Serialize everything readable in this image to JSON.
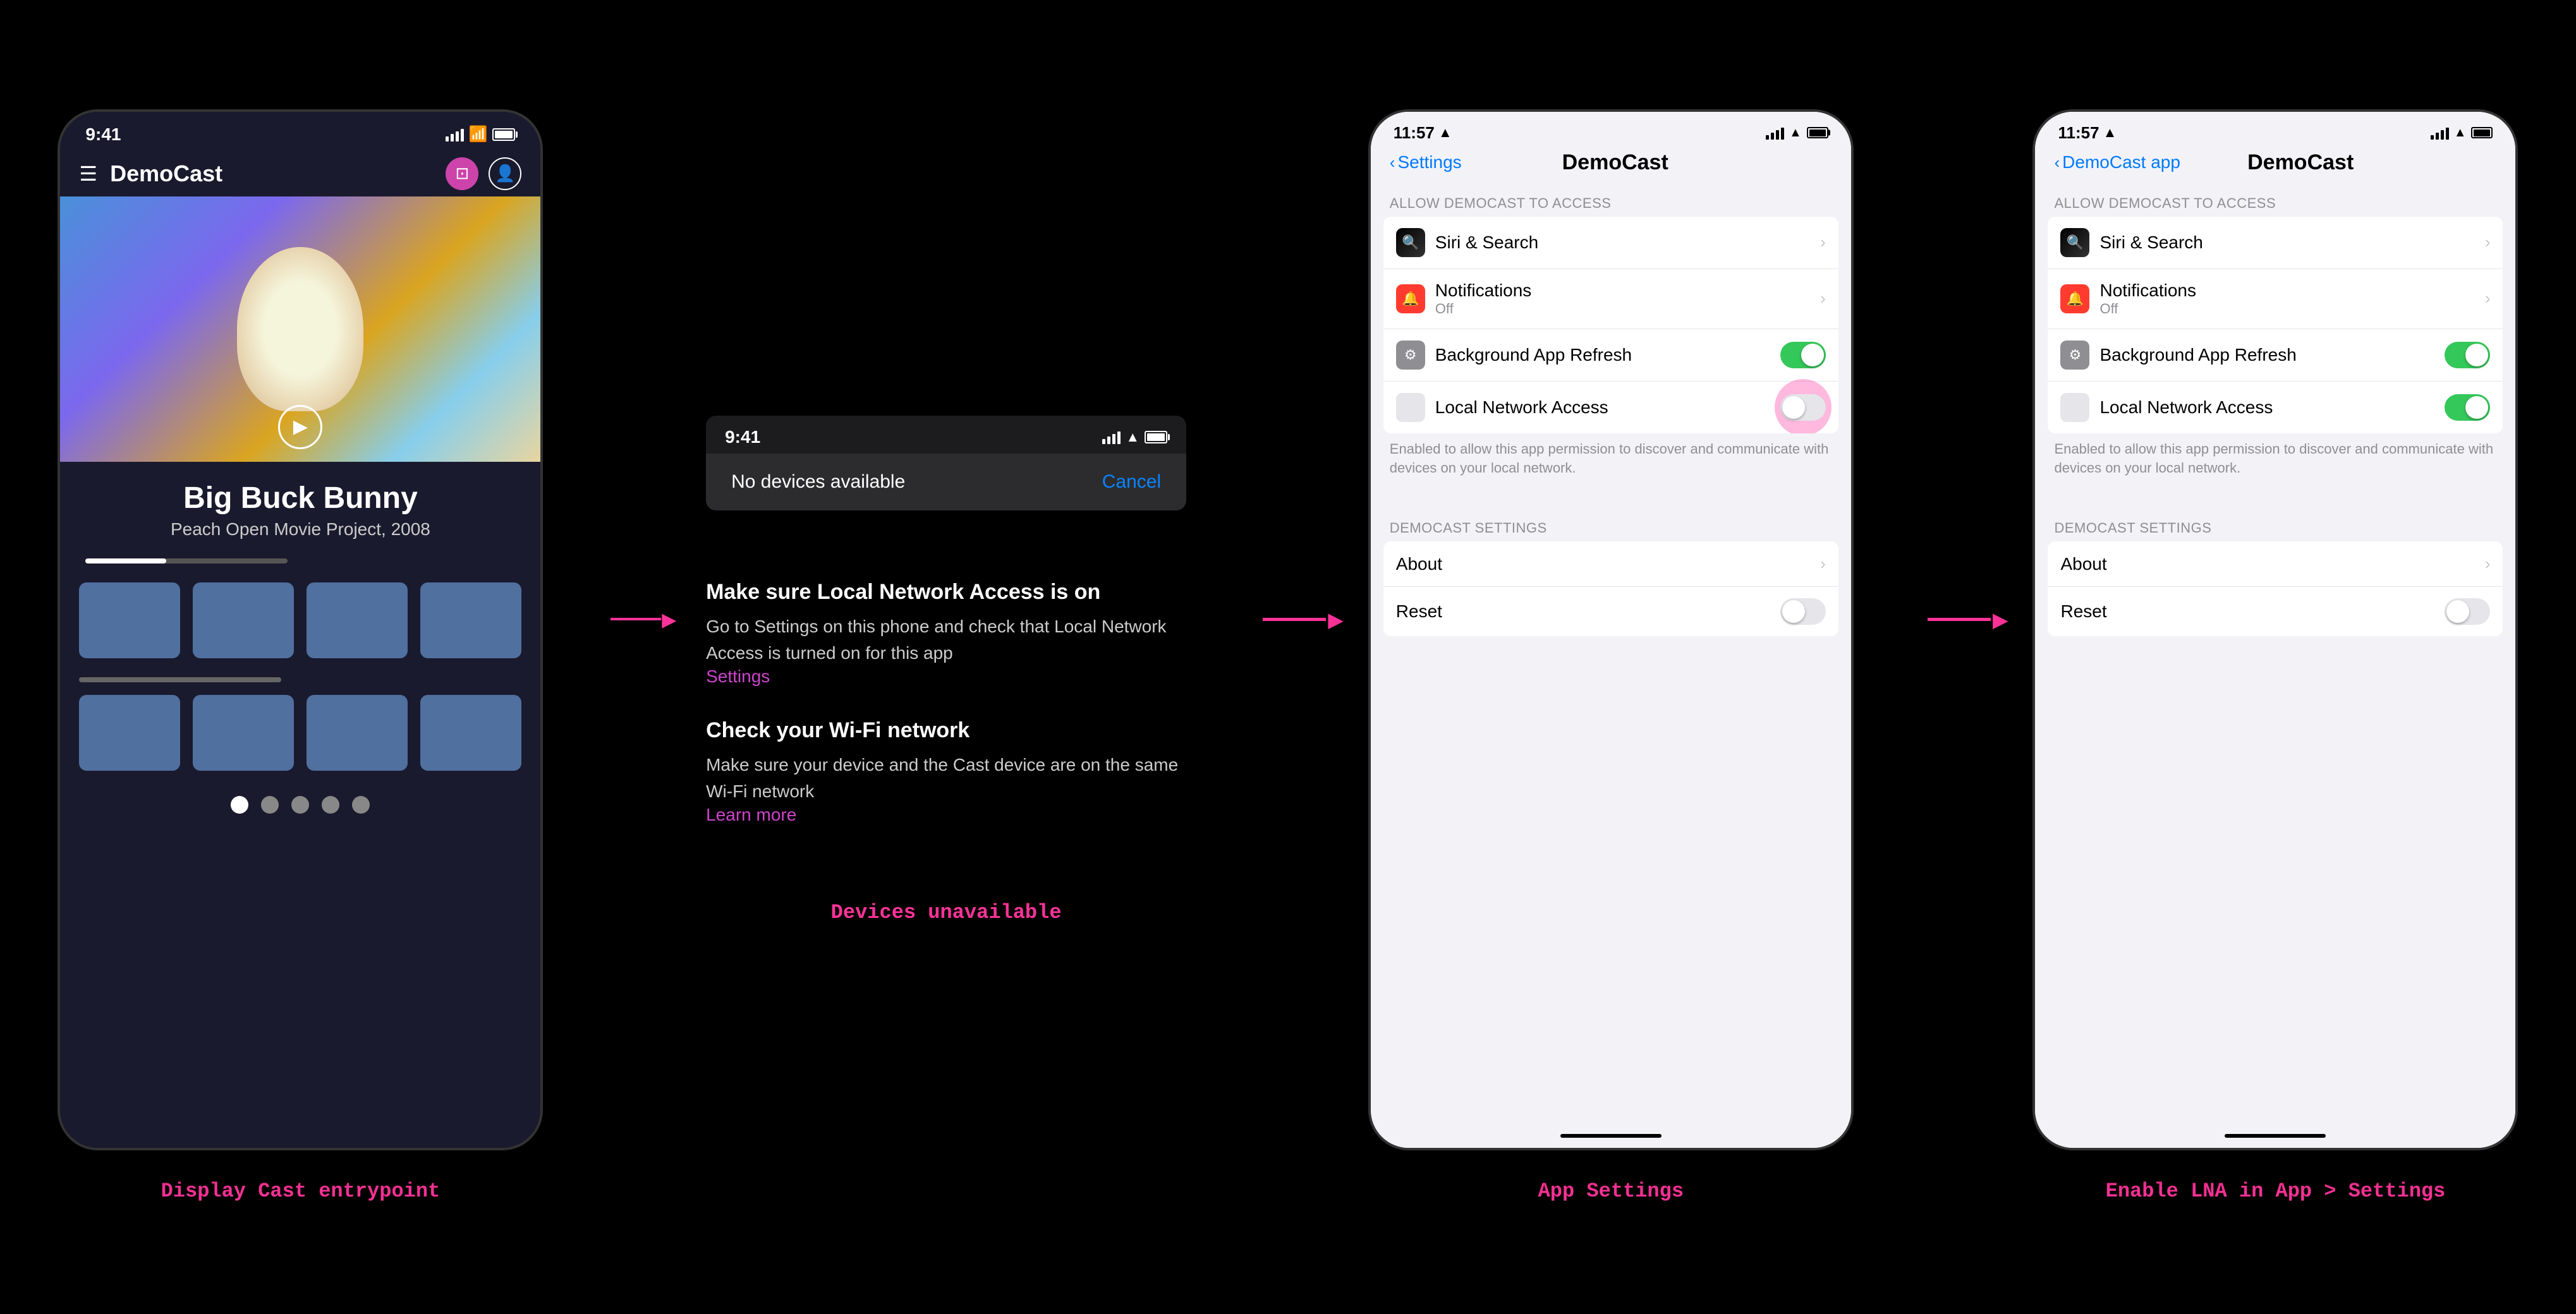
{
  "section1": {
    "caption": "Display Cast entrypoint",
    "phone": {
      "time": "9:41",
      "app_title": "DemoCast",
      "movie_title": "Big Buck Bunny",
      "movie_subtitle": "Peach Open Movie Project, 2008"
    }
  },
  "section2": {
    "caption": "Devices unavailable",
    "time": "9:41",
    "no_devices_text": "No devices available",
    "cancel_label": "Cancel",
    "instruction1_title": "Make sure Local Network Access is on",
    "instruction1_body": "Go to Settings on this phone and check that Local Network Access is turned on for this app",
    "instruction1_link": "Settings",
    "instruction2_title": "Check your Wi-Fi network",
    "instruction2_body": "Make sure your device and the Cast device are on the same Wi-Fi network",
    "instruction2_link": "Learn more"
  },
  "section3": {
    "caption": "App Settings",
    "time": "11:57",
    "location_icon": "◀",
    "back_label": "Settings",
    "screen_title": "DemoCast",
    "section_label": "ALLOW DEMOCAST TO ACCESS",
    "rows": [
      {
        "icon_type": "siri",
        "label": "Siri & Search",
        "has_chevron": true
      },
      {
        "icon_type": "notif",
        "label": "Notifications",
        "sublabel": "Off",
        "has_chevron": true
      },
      {
        "icon_type": "gear",
        "label": "Background App Refresh",
        "toggle": true,
        "toggle_on": true
      },
      {
        "icon_type": "network",
        "label": "Local Network Access",
        "toggle": true,
        "toggle_on": false,
        "pulsing": true
      }
    ],
    "network_note": "Enabled to allow this app permission to discover and communicate with devices on your local network.",
    "democast_section_label": "DEMOCAST SETTINGS",
    "democast_rows": [
      {
        "label": "About",
        "has_chevron": true
      },
      {
        "label": "Reset",
        "toggle": true,
        "toggle_on": false
      }
    ]
  },
  "section4": {
    "caption": "Enable LNA in App > Settings",
    "time": "11:57",
    "location_icon": "◀",
    "back_label": "DemoCast app",
    "screen_title": "DemoCast",
    "section_label": "ALLOW DEMOCAST TO ACCESS",
    "rows": [
      {
        "icon_type": "siri",
        "label": "Siri & Search",
        "has_chevron": true
      },
      {
        "icon_type": "notif",
        "label": "Notifications",
        "sublabel": "Off",
        "has_chevron": true
      },
      {
        "icon_type": "gear",
        "label": "Background App Refresh",
        "toggle": true,
        "toggle_on": true
      },
      {
        "icon_type": "network",
        "label": "Local Network Access",
        "toggle": true,
        "toggle_on": true
      }
    ],
    "network_note": "Enabled to allow this app permission to discover and communicate with devices on your local network.",
    "democast_section_label": "DEMOCAST SETTINGS",
    "democast_rows": [
      {
        "label": "About",
        "has_chevron": true
      },
      {
        "label": "Reset",
        "toggle": true,
        "toggle_on": false
      }
    ]
  }
}
